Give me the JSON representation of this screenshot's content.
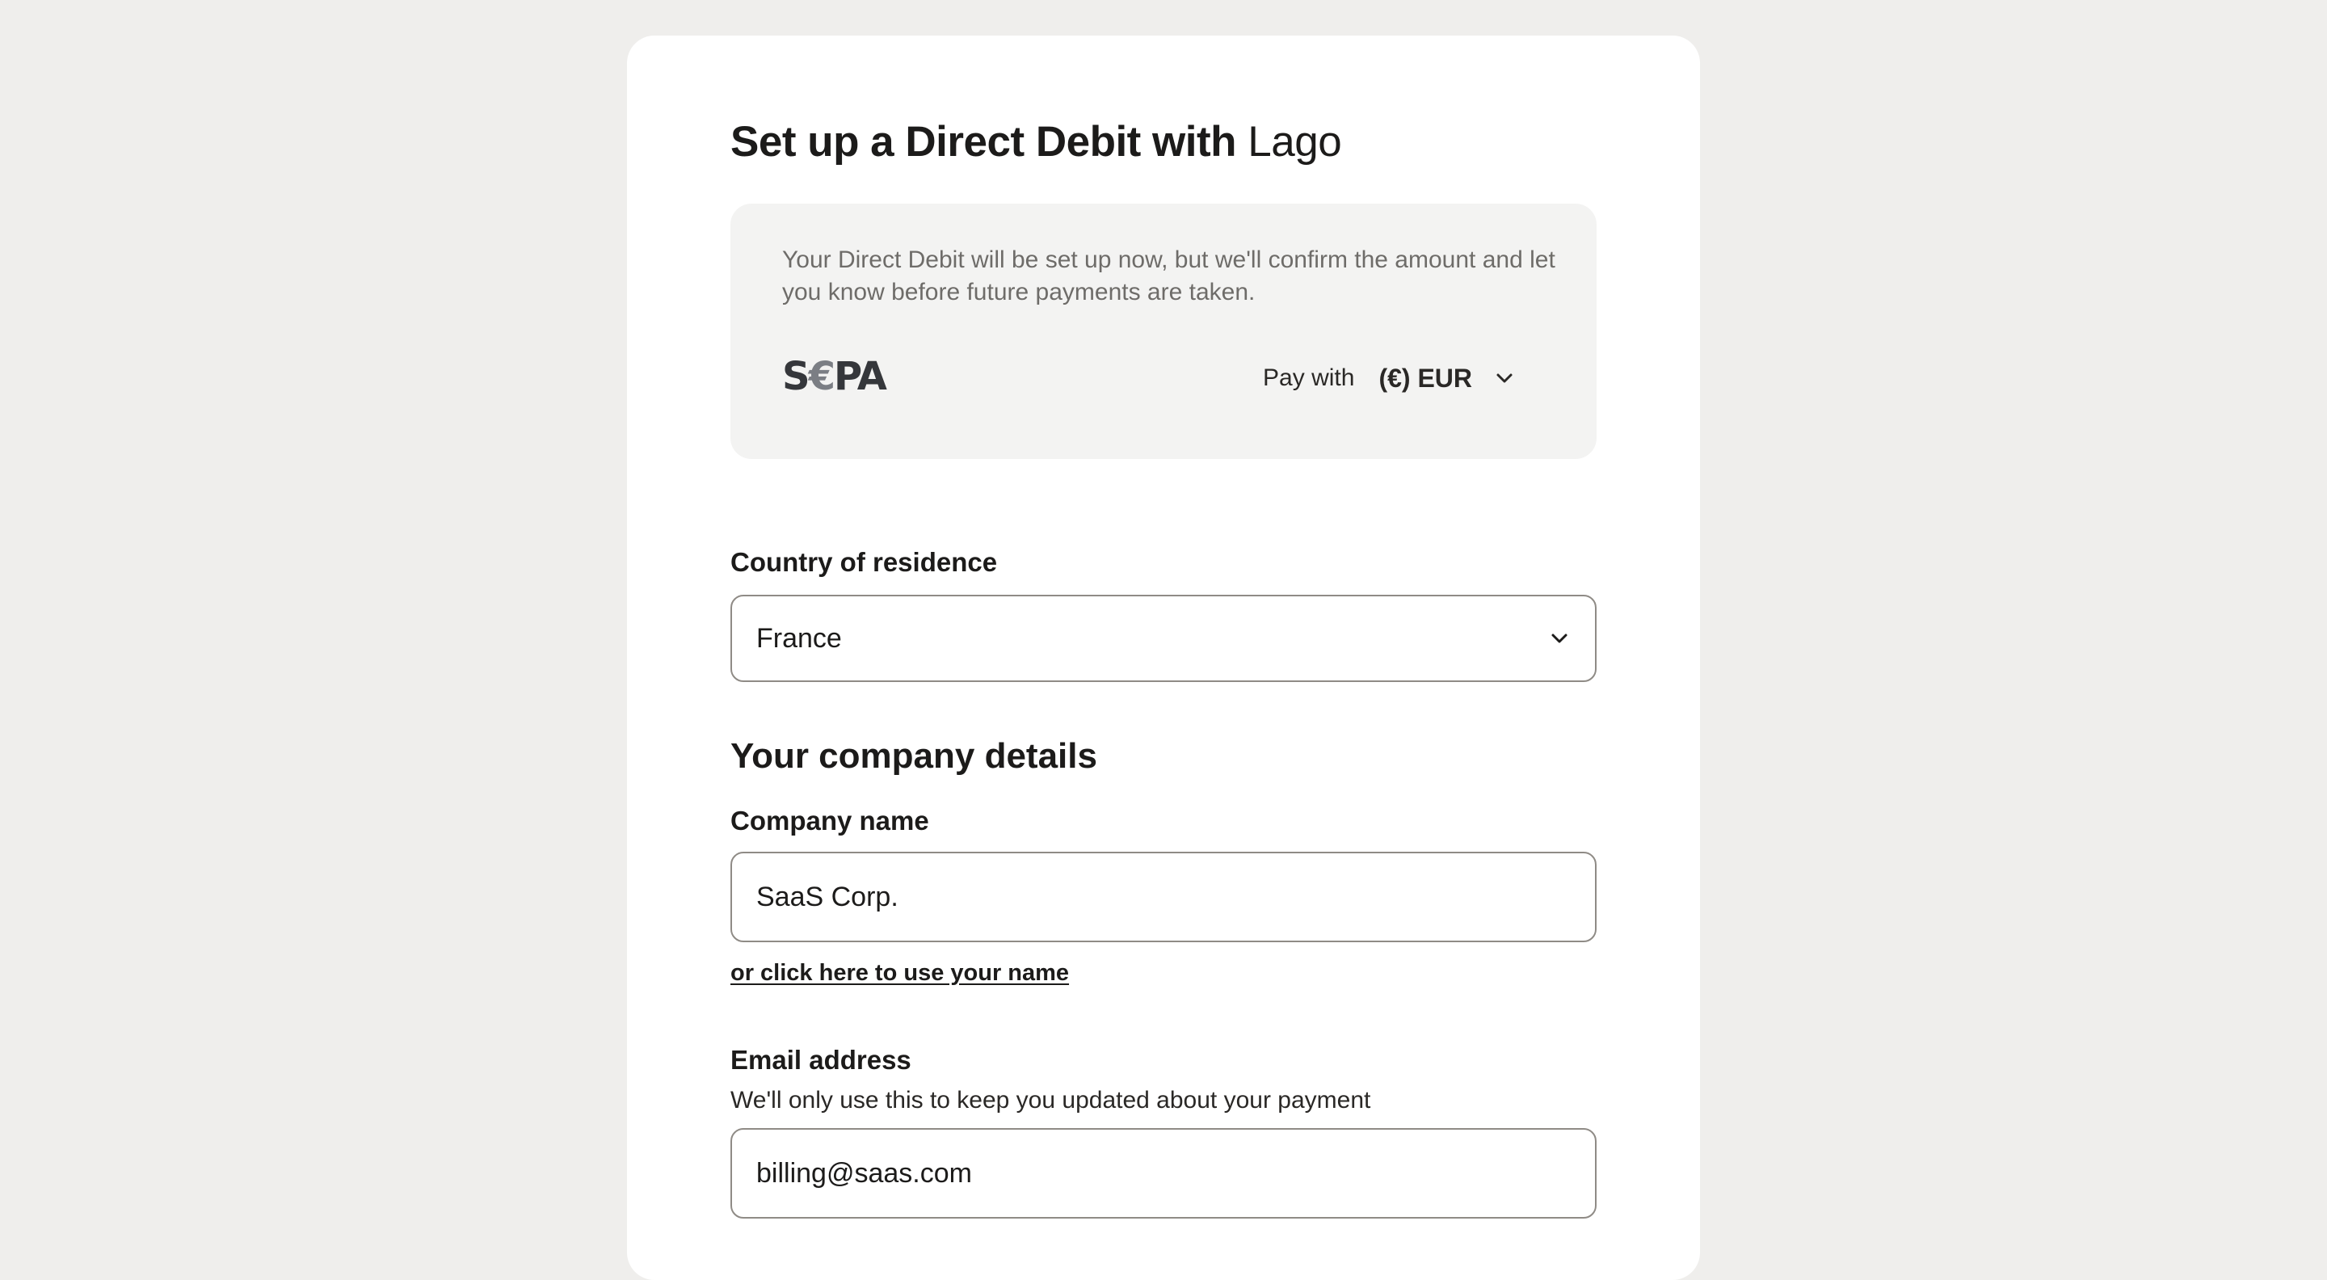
{
  "header": {
    "title_main": "Set up a Direct Debit with",
    "title_brand": "Lago"
  },
  "info": {
    "text": "Your Direct Debit will be set up now, but we'll confirm the amount and let you know before future payments are taken.",
    "scheme_logo": {
      "prefix": "S",
      "euro": "€",
      "suffix": "PA"
    },
    "pay_with_label": "Pay with",
    "currency": "(€) EUR"
  },
  "country": {
    "label": "Country of residence",
    "value": "France"
  },
  "company_section": {
    "title": "Your company details",
    "company_name_label": "Company name",
    "company_name_value": "SaaS Corp.",
    "use_name_link": "or click here to use your name"
  },
  "email": {
    "label": "Email address",
    "hint": "We'll only use this to keep you updated about your payment",
    "value": "billing@saas.com"
  },
  "icons": {
    "currency_chevron": "chevron-down-icon",
    "country_chevron": "chevron-down-icon"
  }
}
